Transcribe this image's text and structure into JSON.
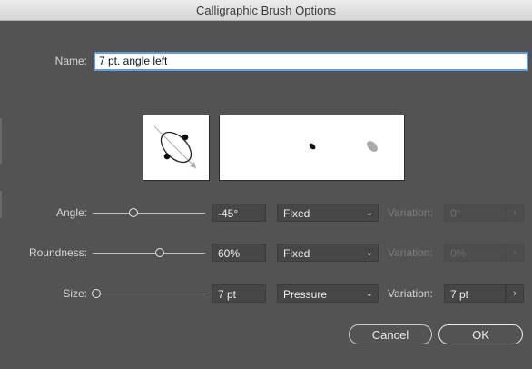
{
  "window": {
    "title": "Calligraphic Brush Options"
  },
  "name_field": {
    "label": "Name:",
    "value": "7 pt. angle left"
  },
  "rows": [
    {
      "label": "Angle:",
      "value": "-45°",
      "mode": "Fixed",
      "variation_label": "Variation:",
      "variation_value": "0°",
      "slider_level": 0.37,
      "variation_enabled": false
    },
    {
      "label": "Roundness:",
      "value": "60%",
      "mode": "Fixed",
      "variation_label": "Variation:",
      "variation_value": "0%",
      "slider_level": 0.6,
      "variation_enabled": false
    },
    {
      "label": "Size:",
      "value": "7 pt",
      "mode": "Pressure",
      "variation_label": "Variation:",
      "variation_value": "7 pt",
      "slider_level": 0.0,
      "variation_enabled": true
    }
  ],
  "buttons": {
    "cancel": "Cancel",
    "ok": "OK"
  },
  "icons": {
    "chevron": "chevron-down-icon",
    "step": "chevron-right-icon"
  },
  "colors": {
    "dialog_bg": "#535353",
    "field_bg": "#464646",
    "focus_ring": "#5aa0e6"
  }
}
